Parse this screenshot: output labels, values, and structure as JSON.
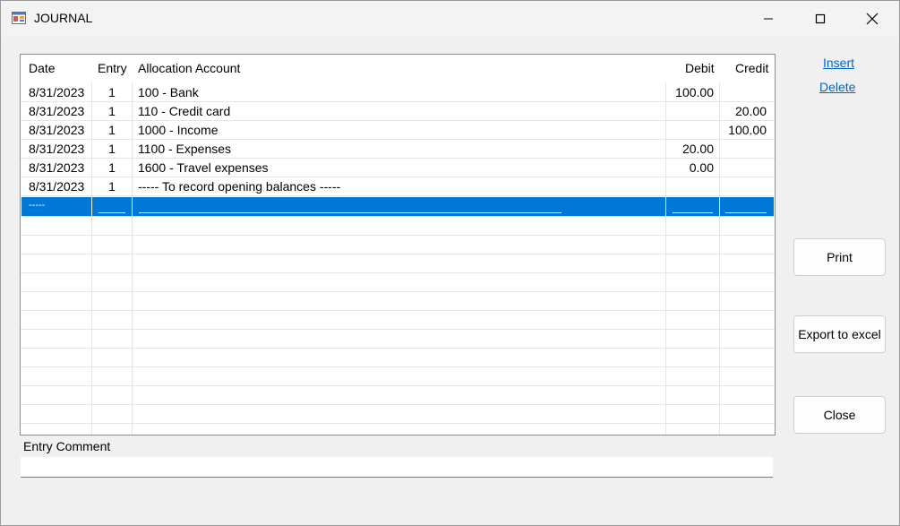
{
  "window": {
    "title": "JOURNAL",
    "icons": {
      "app": "app-window-icon",
      "minimize": "minimize-icon",
      "maximize": "maximize-icon",
      "close": "close-icon"
    }
  },
  "grid": {
    "columns": {
      "date": "Date",
      "entry": "Entry",
      "account": "Allocation Account",
      "debit": "Debit",
      "credit": "Credit"
    },
    "rows": [
      {
        "date": "8/31/2023",
        "entry": "1",
        "account": "100 - Bank",
        "debit": "100.00",
        "credit": ""
      },
      {
        "date": "8/31/2023",
        "entry": "1",
        "account": "110 - Credit card",
        "debit": "",
        "credit": "20.00"
      },
      {
        "date": "8/31/2023",
        "entry": "1",
        "account": "1000 - Income",
        "debit": "",
        "credit": "100.00"
      },
      {
        "date": "8/31/2023",
        "entry": "1",
        "account": "1100 - Expenses",
        "debit": "20.00",
        "credit": ""
      },
      {
        "date": "8/31/2023",
        "entry": "1",
        "account": "1600 - Travel expenses",
        "debit": "0.00",
        "credit": ""
      },
      {
        "date": "8/31/2023",
        "entry": "1",
        "account": "----- To record opening balances -----",
        "debit": "",
        "credit": ""
      }
    ],
    "new_row": {
      "date": "-----"
    },
    "selection_color": "#0078d7"
  },
  "actions": {
    "insert": "Insert",
    "delete": "Delete",
    "print": "Print",
    "export": "Export to excel",
    "close": "Close"
  },
  "comment": {
    "label": "Entry Comment",
    "value": ""
  }
}
